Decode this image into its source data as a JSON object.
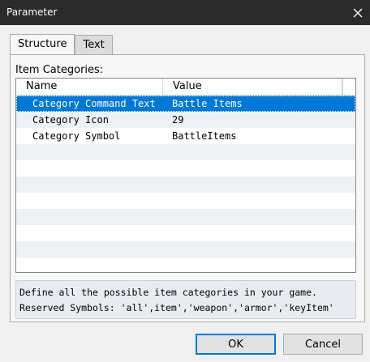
{
  "window": {
    "title": "Parameter",
    "close_icon": "close-icon"
  },
  "tabs": [
    {
      "label": "Structure",
      "active": true
    },
    {
      "label": "Text",
      "active": false
    }
  ],
  "group_label": "Item Categories:",
  "table": {
    "columns": [
      "Name",
      "Value"
    ],
    "rows": [
      {
        "name": "Category Command Text",
        "value": "Battle Items",
        "selected": true
      },
      {
        "name": "Category Icon",
        "value": "29",
        "selected": false
      },
      {
        "name": "Category Symbol",
        "value": "BattleItems",
        "selected": false
      }
    ],
    "empty_rows": 8
  },
  "help": {
    "line1": "Define all the possible item categories in your game.",
    "line2": "Reserved Symbols: 'all',item','weapon','armor','keyItem'"
  },
  "buttons": {
    "ok": "OK",
    "cancel": "Cancel"
  },
  "colors": {
    "selection": "#0078d7",
    "titlebar": "#2b2b2b",
    "alt_row": "#eef1f4"
  }
}
